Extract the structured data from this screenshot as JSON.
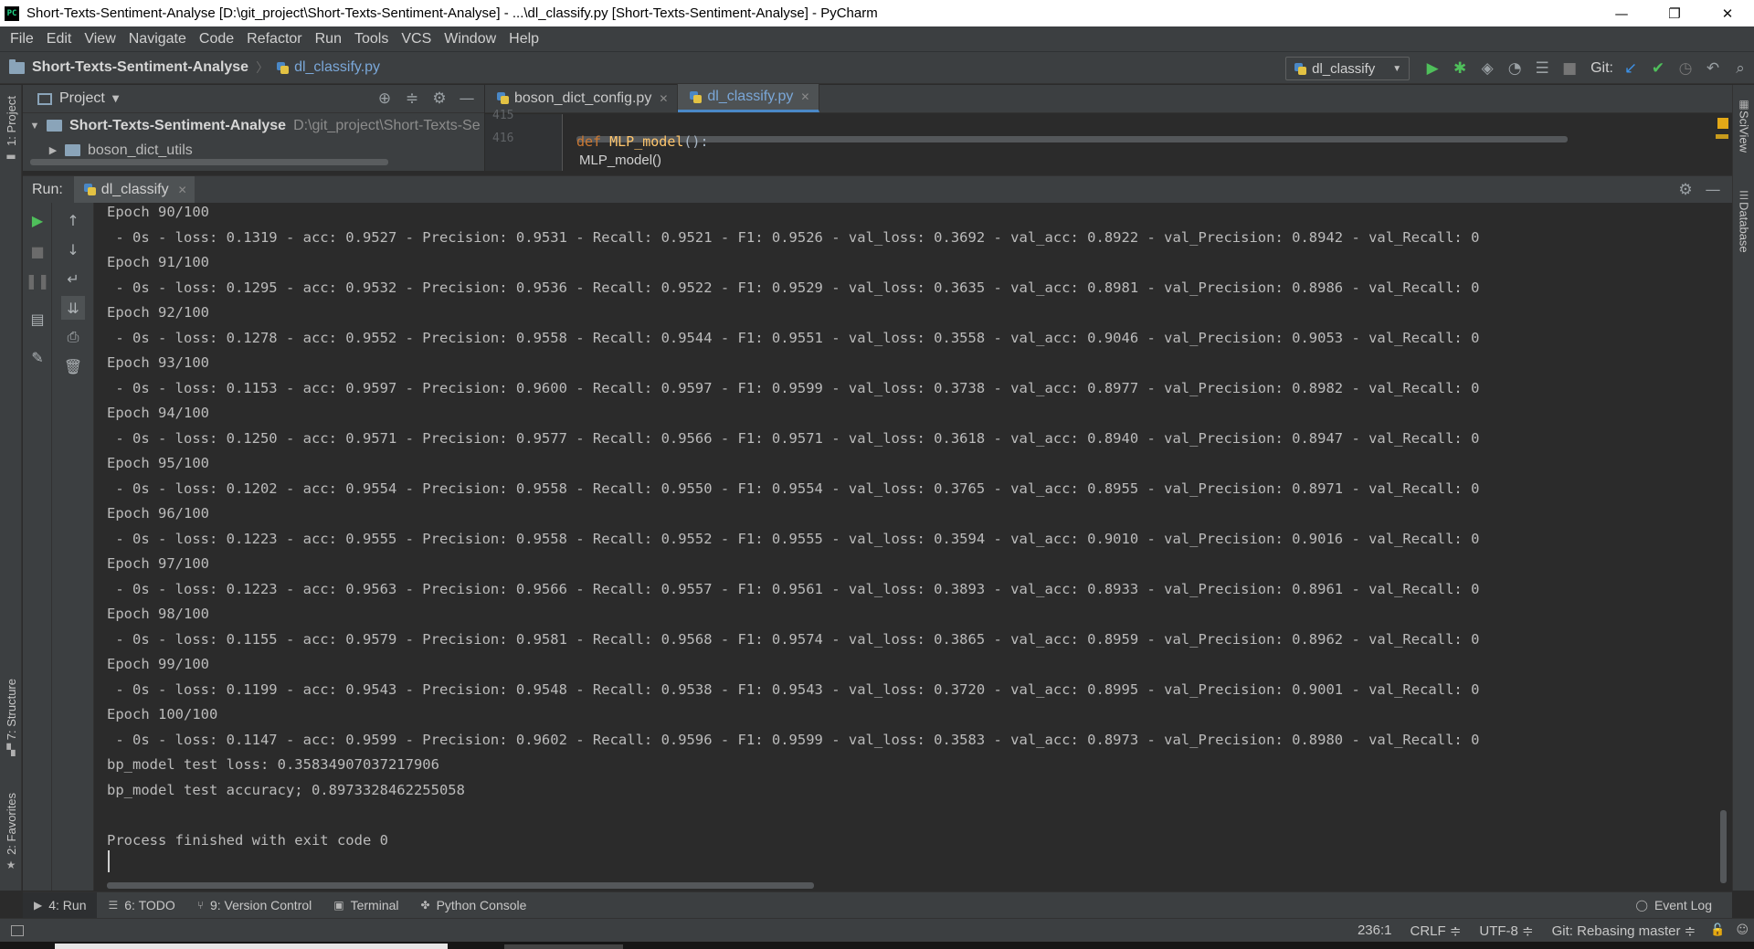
{
  "window": {
    "title": "Short-Texts-Sentiment-Analyse [D:\\git_project\\Short-Texts-Sentiment-Analyse] - ...\\dl_classify.py [Short-Texts-Sentiment-Analyse] - PyCharm",
    "app_icon_text": "PC",
    "minimize": "—",
    "restore": "❐",
    "close": "✕"
  },
  "menu": [
    "File",
    "Edit",
    "View",
    "Navigate",
    "Code",
    "Refactor",
    "Run",
    "Tools",
    "VCS",
    "Window",
    "Help"
  ],
  "nav": {
    "project": "Short-Texts-Sentiment-Analyse",
    "file": "dl_classify.py",
    "run_config": "dl_classify",
    "git_label": "Git:"
  },
  "side_tabs": {
    "project": "1: Project",
    "structure": "7: Structure",
    "favorites": "2: Favorites",
    "sciview": "SciView",
    "database": "Database"
  },
  "project_panel": {
    "title": "Project",
    "root_name": "Short-Texts-Sentiment-Analyse",
    "root_path": "D:\\git_project\\Short-Texts-Se",
    "child": "boson_dict_utils"
  },
  "editor": {
    "tabs": [
      {
        "label": "boson_dict_config.py",
        "active": false
      },
      {
        "label": "dl_classify.py",
        "active": true
      }
    ],
    "line_prev": "415",
    "line_num": "416",
    "code_kw": "def ",
    "code_fn": "MLP_model",
    "code_rest": "():",
    "breadcrumb": "MLP_model()"
  },
  "run": {
    "label": "Run:",
    "tab": "dl_classify",
    "console_lines": [
      "Epoch 90/100",
      " - 0s - loss: 0.1319 - acc: 0.9527 - Precision: 0.9531 - Recall: 0.9521 - F1: 0.9526 - val_loss: 0.3692 - val_acc: 0.8922 - val_Precision: 0.8942 - val_Recall: 0",
      "Epoch 91/100",
      " - 0s - loss: 0.1295 - acc: 0.9532 - Precision: 0.9536 - Recall: 0.9522 - F1: 0.9529 - val_loss: 0.3635 - val_acc: 0.8981 - val_Precision: 0.8986 - val_Recall: 0",
      "Epoch 92/100",
      " - 0s - loss: 0.1278 - acc: 0.9552 - Precision: 0.9558 - Recall: 0.9544 - F1: 0.9551 - val_loss: 0.3558 - val_acc: 0.9046 - val_Precision: 0.9053 - val_Recall: 0",
      "Epoch 93/100",
      " - 0s - loss: 0.1153 - acc: 0.9597 - Precision: 0.9600 - Recall: 0.9597 - F1: 0.9599 - val_loss: 0.3738 - val_acc: 0.8977 - val_Precision: 0.8982 - val_Recall: 0",
      "Epoch 94/100",
      " - 0s - loss: 0.1250 - acc: 0.9571 - Precision: 0.9577 - Recall: 0.9566 - F1: 0.9571 - val_loss: 0.3618 - val_acc: 0.8940 - val_Precision: 0.8947 - val_Recall: 0",
      "Epoch 95/100",
      " - 0s - loss: 0.1202 - acc: 0.9554 - Precision: 0.9558 - Recall: 0.9550 - F1: 0.9554 - val_loss: 0.3765 - val_acc: 0.8955 - val_Precision: 0.8971 - val_Recall: 0",
      "Epoch 96/100",
      " - 0s - loss: 0.1223 - acc: 0.9555 - Precision: 0.9558 - Recall: 0.9552 - F1: 0.9555 - val_loss: 0.3594 - val_acc: 0.9010 - val_Precision: 0.9016 - val_Recall: 0",
      "Epoch 97/100",
      " - 0s - loss: 0.1223 - acc: 0.9563 - Precision: 0.9566 - Recall: 0.9557 - F1: 0.9561 - val_loss: 0.3893 - val_acc: 0.8933 - val_Precision: 0.8961 - val_Recall: 0",
      "Epoch 98/100",
      " - 0s - loss: 0.1155 - acc: 0.9579 - Precision: 0.9581 - Recall: 0.9568 - F1: 0.9574 - val_loss: 0.3865 - val_acc: 0.8959 - val_Precision: 0.8962 - val_Recall: 0",
      "Epoch 99/100",
      " - 0s - loss: 0.1199 - acc: 0.9543 - Precision: 0.9548 - Recall: 0.9538 - F1: 0.9543 - val_loss: 0.3720 - val_acc: 0.8995 - val_Precision: 0.9001 - val_Recall: 0",
      "Epoch 100/100",
      " - 0s - loss: 0.1147 - acc: 0.9599 - Precision: 0.9602 - Recall: 0.9596 - F1: 0.9599 - val_loss: 0.3583 - val_acc: 0.8973 - val_Precision: 0.8980 - val_Recall: 0",
      "bp_model test loss: 0.35834907037217906",
      "bp_model test accuracy; 0.8973328462255058",
      "",
      "Process finished with exit code 0"
    ]
  },
  "bottom_tabs": {
    "run": "4: Run",
    "todo": "6: TODO",
    "vcs": "9: Version Control",
    "terminal": "Terminal",
    "python_console": "Python Console",
    "event_log": "Event Log"
  },
  "status": {
    "position": "236:1",
    "line_sep": "CRLF ≑",
    "encoding": "UTF-8 ≑",
    "git": "Git: Rebasing master ≑"
  },
  "colors": {
    "background": "#2b2b2b",
    "panel": "#3c3f41",
    "accent_blue": "#4a88c7",
    "run_green": "#4fbf5b"
  }
}
